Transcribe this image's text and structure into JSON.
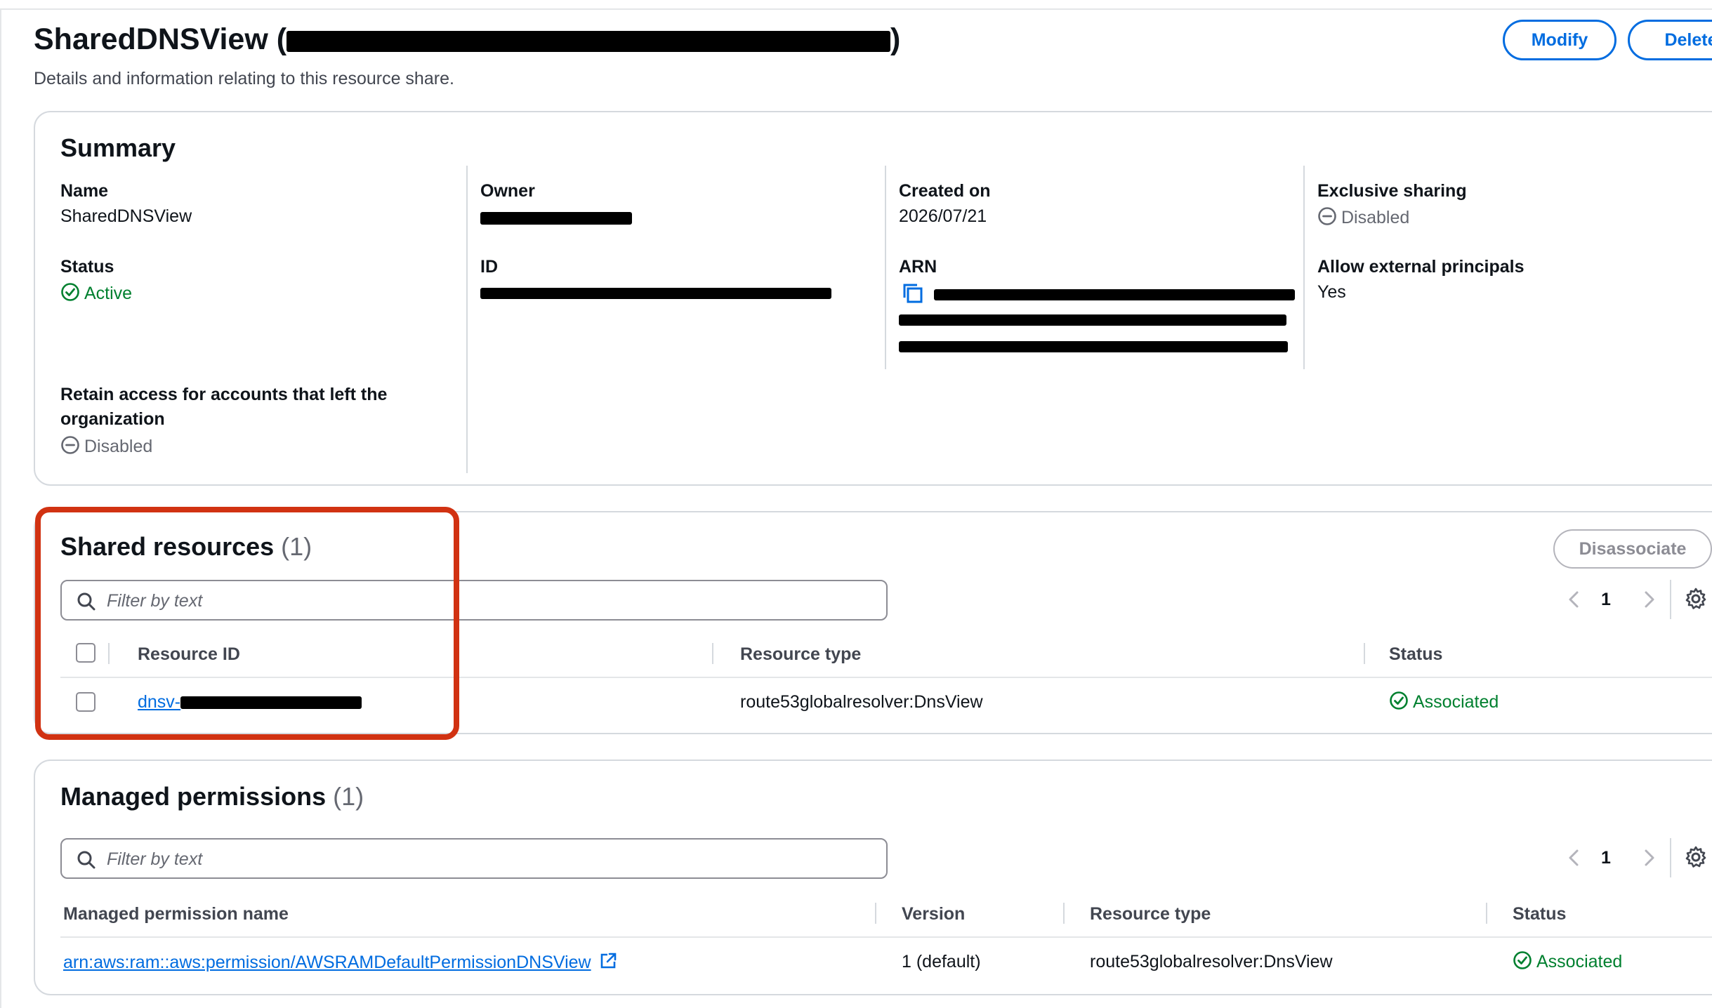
{
  "header": {
    "title": "SharedDNSView (",
    "title_suffix": ")",
    "description": "Details and information relating to this resource share.",
    "modify_label": "Modify",
    "delete_label": "Delete"
  },
  "summary": {
    "heading": "Summary",
    "name_label": "Name",
    "name_value": "SharedDNSView",
    "status_label": "Status",
    "status_value": "Active",
    "retain_label_line1": "Retain access for accounts that left the",
    "retain_label_line2": "organization",
    "retain_value": "Disabled",
    "owner_label": "Owner",
    "id_label": "ID",
    "created_label": "Created on",
    "created_value": "2026/07/21",
    "arn_label": "ARN",
    "exclusive_label": "Exclusive sharing",
    "exclusive_value": "Disabled",
    "external_label": "Allow external principals",
    "external_value": "Yes"
  },
  "shared_resources": {
    "heading": "Shared resources",
    "count": "(1)",
    "disassociate_label": "Disassociate",
    "filter_placeholder": "Filter by text",
    "page": "1",
    "columns": [
      "Resource ID",
      "Resource type",
      "Status"
    ],
    "rows": [
      {
        "resource_id_prefix": "dnsv-",
        "resource_type": "route53globalresolver:DnsView",
        "status": "Associated"
      }
    ]
  },
  "managed_permissions": {
    "heading": "Managed permissions",
    "count": "(1)",
    "filter_placeholder": "Filter by text",
    "page": "1",
    "columns": [
      "Managed permission name",
      "Version",
      "Resource type",
      "Status"
    ],
    "rows": [
      {
        "name": "arn:aws:ram::aws:permission/AWSRAMDefaultPermissionDNSView",
        "version": "1 (default)",
        "resource_type": "route53globalresolver:DnsView",
        "status": "Associated"
      }
    ]
  },
  "colors": {
    "accent": "#006ce0",
    "success": "#00802f",
    "highlight": "#d13212"
  }
}
